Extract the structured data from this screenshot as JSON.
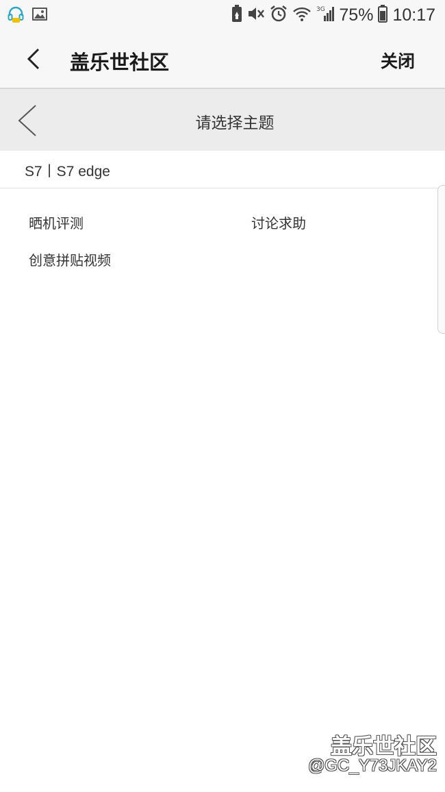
{
  "status_bar": {
    "left_icons": [
      "headset-notification-icon",
      "gallery-notification-icon"
    ],
    "right_icons": [
      "battery-saver-icon",
      "mute-icon",
      "alarm-icon",
      "wifi-icon",
      "signal-3g-icon",
      "battery-icon"
    ],
    "battery": "75%",
    "time": "10:17"
  },
  "appbar": {
    "title": "盖乐世社区",
    "close_label": "关闭"
  },
  "subheader": {
    "title": "请选择主题"
  },
  "board": {
    "name": "S7丨S7 edge"
  },
  "topics": [
    {
      "label": "晒机评测"
    },
    {
      "label": "讨论求助"
    },
    {
      "label": "创意拼贴视频"
    }
  ],
  "watermark": {
    "brand": "盖乐世社区",
    "user": "@GC_Y73JKAY2"
  },
  "colors": {
    "status_bg": "#f7f7f7",
    "subheader_bg": "#ececec",
    "notification_accent": "#2ba6c8",
    "notification_yellow": "#f2c200"
  }
}
